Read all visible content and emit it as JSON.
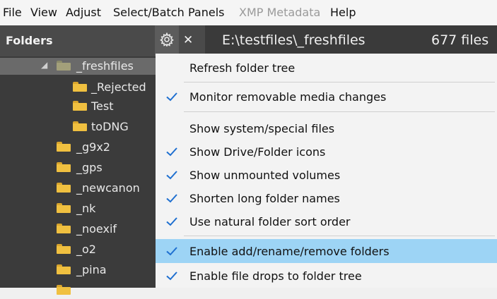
{
  "menubar": {
    "items": [
      {
        "label": "File",
        "enabled": true
      },
      {
        "label": "View",
        "enabled": true
      },
      {
        "label": "Adjust",
        "enabled": true
      },
      {
        "label": "Select/Batch",
        "enabled": true
      },
      {
        "label": "Panels",
        "enabled": true
      },
      {
        "label": "XMP Metadata",
        "enabled": false
      },
      {
        "label": "Help",
        "enabled": true
      }
    ]
  },
  "panel": {
    "title": "Folders",
    "gear_icon": "gear-icon",
    "close_label": "✕"
  },
  "pathbar": {
    "path": "E:\\testfiles\\_freshfiles",
    "count": "677 files"
  },
  "tree": [
    {
      "label": "_freshfiles",
      "level": 0,
      "expanded": true,
      "selected": true,
      "color": "#8a8a6a"
    },
    {
      "label": "_Rejected",
      "level": 1,
      "color": "#f0c040"
    },
    {
      "label": "Test",
      "level": 1,
      "color": "#f0c040"
    },
    {
      "label": "toDNG",
      "level": 1,
      "color": "#f0c040"
    },
    {
      "label": "_g9x2",
      "level": 0,
      "color": "#f0c040"
    },
    {
      "label": "_gps",
      "level": 0,
      "color": "#f0c040"
    },
    {
      "label": "_newcanon",
      "level": 0,
      "color": "#f0c040"
    },
    {
      "label": "_nk",
      "level": 0,
      "color": "#f0c040"
    },
    {
      "label": "_noexif",
      "level": 0,
      "color": "#f0c040"
    },
    {
      "label": "_o2",
      "level": 0,
      "color": "#f0c040"
    },
    {
      "label": "_pina",
      "level": 0,
      "color": "#f0c040"
    },
    {
      "label": "",
      "level": 0,
      "color": "#f0c040"
    }
  ],
  "menu": {
    "items": [
      {
        "label": "Refresh folder tree",
        "checked": false
      },
      {
        "label": "Monitor removable media changes",
        "checked": true
      },
      {
        "label": "Show system/special files",
        "checked": false
      },
      {
        "label": "Show Drive/Folder icons",
        "checked": true
      },
      {
        "label": "Show unmounted volumes",
        "checked": true
      },
      {
        "label": "Shorten long folder names",
        "checked": true
      },
      {
        "label": "Use natural folder sort order",
        "checked": true
      },
      {
        "label": "Enable add/rename/remove folders",
        "checked": true,
        "highlighted": true
      },
      {
        "label": "Enable file drops to folder tree",
        "checked": true
      }
    ]
  },
  "colors": {
    "check": "#1e6fd0",
    "highlight": "#9dd4f5"
  }
}
